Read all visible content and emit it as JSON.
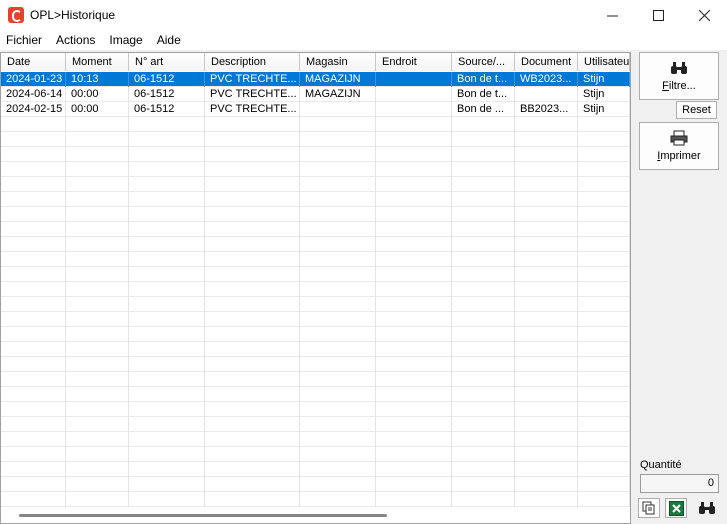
{
  "window": {
    "title": "OPL>Historique",
    "controls": {
      "minimize": "—",
      "maximize": "☐",
      "close": "✕"
    }
  },
  "menu": [
    "Fichier",
    "Actions",
    "Image",
    "Aide"
  ],
  "grid": {
    "columns": [
      "Date",
      "Moment",
      "N° art",
      "Description",
      "Magasin",
      "Endroit",
      "Source/...",
      "Document",
      "Utilisateur"
    ],
    "rows": [
      [
        "2024-01-23",
        "10:13",
        "06-1512",
        "PVC TRECHTE...",
        "MAGAZIJN",
        "",
        "Bon de t...",
        "WB2023...",
        "Stijn"
      ],
      [
        "2024-06-14",
        "00:00",
        "06-1512",
        "PVC TRECHTE...",
        "MAGAZIJN",
        "",
        "Bon de t...",
        "",
        "Stijn"
      ],
      [
        "2024-02-15",
        "00:00",
        "06-1512",
        "PVC TRECHTE...",
        "",
        "",
        "Bon de ...",
        "BB2023...",
        "Stijn"
      ]
    ],
    "selected_row": 0,
    "selection_color": "#0078d7"
  },
  "side": {
    "filter_label": "Filtre...",
    "reset_label": "Reset",
    "print_label": "Imprimer",
    "quantity_label": "Quantité",
    "quantity_value": "0",
    "icons": {
      "filter": "binoculars-icon",
      "print": "printer-icon",
      "copy": "copy-icon",
      "excel": "excel-icon",
      "search": "binoculars-icon"
    }
  },
  "colors": {
    "app_icon": "#e8402a",
    "excel": "#1e7a3c"
  }
}
